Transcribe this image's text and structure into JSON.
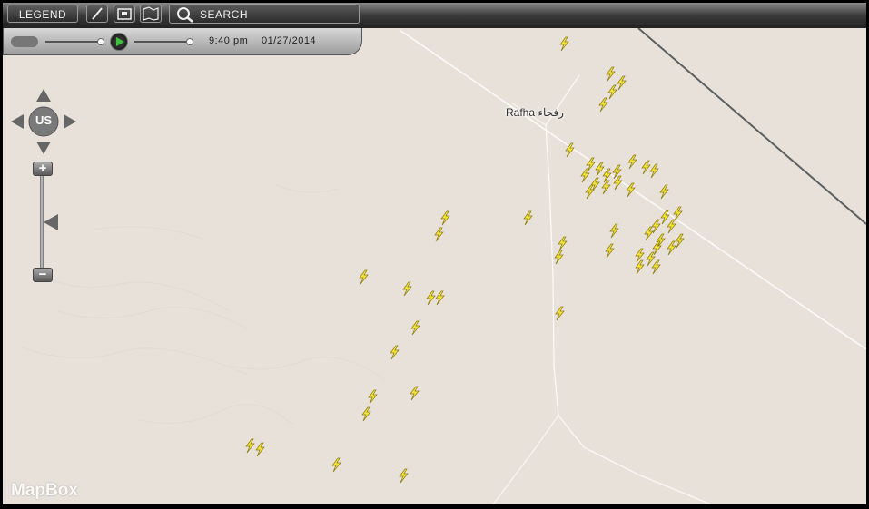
{
  "toolbar": {
    "legend_label": "LEGEND",
    "search_label": "SEARCH",
    "tools": [
      "pencil-icon",
      "frame-icon",
      "map-pin-icon"
    ]
  },
  "timebar": {
    "time": "9:40 pm",
    "date": "01/27/2014"
  },
  "nav": {
    "region_label": "US",
    "zoom_in_label": "+",
    "zoom_out_label": "−"
  },
  "map": {
    "city_label": "Rafha رفحاء",
    "attribution": "MapBox",
    "background_color": "#e8e1da",
    "strike_color": "#f2e23a",
    "strike_icon": "lightning-bolt-icon"
  }
}
